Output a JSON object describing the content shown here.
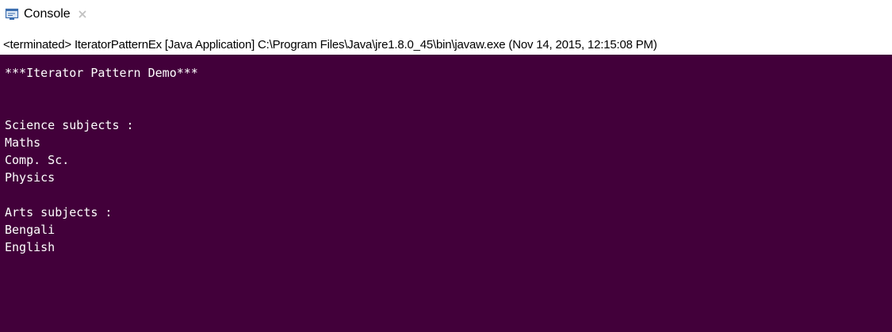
{
  "tab": {
    "label": "Console",
    "icon": "console-icon",
    "close_icon": "close-icon"
  },
  "status": {
    "text": "<terminated> IteratorPatternEx [Java Application] C:\\Program Files\\Java\\jre1.8.0_45\\bin\\javaw.exe (Nov 14, 2015, 12:15:08 PM)"
  },
  "console": {
    "background": "#42003a",
    "text_color": "#ffffff",
    "lines": [
      "***Iterator Pattern Demo***",
      "",
      "",
      "Science subjects :",
      "Maths",
      "Comp. Sc.",
      "Physics",
      "",
      "Arts subjects :",
      "Bengali",
      "English"
    ]
  }
}
